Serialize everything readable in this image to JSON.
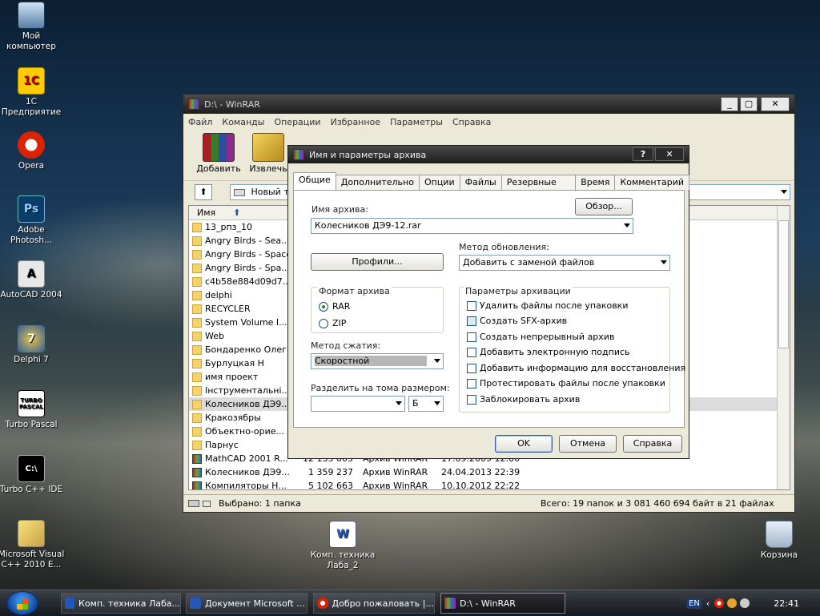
{
  "desktop": {
    "icons": [
      {
        "label": "Мой\nкомпьютер",
        "icon": "my-computer-icon"
      },
      {
        "label": "1С\nПредприятие",
        "icon": "1c-icon"
      },
      {
        "label": "Opera",
        "icon": "opera-icon"
      },
      {
        "label": "Adobe\nPhotosh...",
        "icon": "photoshop-icon"
      },
      {
        "label": "AutoCAD 2004",
        "icon": "autocad-icon"
      },
      {
        "label": "Delphi 7",
        "icon": "delphi-icon"
      },
      {
        "label": "Turbo Pascal",
        "icon": "turbo-pascal-icon"
      },
      {
        "label": "Turbo C++ IDE",
        "icon": "turbo-cpp-icon"
      },
      {
        "label": "Microsoft Visual\nC++ 2010 E...",
        "icon": "visual-cpp-icon"
      },
      {
        "label": "Комп. техника\nЛаба_2",
        "icon": "word-doc-icon"
      },
      {
        "label": "Корзина",
        "icon": "recycle-bin-icon"
      }
    ],
    "icon_texts": {
      "ps": "Ps",
      "turbo_pascal": "TURBO PASCAL",
      "turbo_cpp": "C:\\"
    }
  },
  "winrar": {
    "title": "D:\\ - WinRAR",
    "menu": [
      "Файл",
      "Команды",
      "Операции",
      "Избранное",
      "Параметры",
      "Справка"
    ],
    "toolbar": {
      "add": "Добавить",
      "extract": "Извлечь"
    },
    "address": "Новый то",
    "columns": {
      "name": "Имя"
    },
    "rows": [
      {
        "name": "13_рпз_10",
        "kind": "folder"
      },
      {
        "name": "Angry Birds - Sea...",
        "kind": "folder"
      },
      {
        "name": "Angry Birds - Space",
        "kind": "folder"
      },
      {
        "name": "Angry Birds - Spa...",
        "kind": "folder"
      },
      {
        "name": "c4b58e884d09d7...",
        "kind": "folder"
      },
      {
        "name": "delphi",
        "kind": "folder"
      },
      {
        "name": "RECYCLER",
        "kind": "folder"
      },
      {
        "name": "System Volume I...",
        "kind": "folder"
      },
      {
        "name": "Web",
        "kind": "folder"
      },
      {
        "name": "Бондаренко Олег",
        "kind": "folder"
      },
      {
        "name": "Бурлуцкая Н",
        "kind": "folder"
      },
      {
        "name": "имя проект",
        "kind": "folder"
      },
      {
        "name": "Інструментальні...",
        "kind": "folder"
      },
      {
        "name": "Колесников ДЭ9...",
        "kind": "folder",
        "selected": true
      },
      {
        "name": "Кракозябры",
        "kind": "folder"
      },
      {
        "name": "Объектно-орие...",
        "kind": "folder"
      },
      {
        "name": "Парнус",
        "kind": "folder"
      },
      {
        "name": "MathCAD 2001 R...",
        "kind": "rar",
        "size": "12 135 005",
        "type": "Архив WinRAR",
        "date": "17.09.2009 12:00"
      },
      {
        "name": "Колесников ДЭ9...",
        "kind": "rar",
        "size": "1 359 237",
        "type": "Архив WinRAR",
        "date": "24.04.2013 22:39"
      },
      {
        "name": "Компиляторы Н...",
        "kind": "rar",
        "size": "5 102 663",
        "type": "Архив WinRAR",
        "date": "10.10.2012 22:22"
      }
    ],
    "status": {
      "left": "Выбрано: 1 папка",
      "right": "Всего: 19 папок и 3 081 460 694 байт в 21 файлах"
    }
  },
  "dialog": {
    "title": "Имя и параметры архива",
    "help_btn": "?",
    "close_btn": "✕",
    "tabs": [
      "Общие",
      "Дополнительно",
      "Опции",
      "Файлы",
      "Резервные копии",
      "Время",
      "Комментарий"
    ],
    "archive_name_label": "Имя архива:",
    "archive_name": "Колесников ДЭ9-12.rar",
    "browse": "Обзор...",
    "update_method_label": "Метод обновления:",
    "update_method": "Добавить с заменой файлов",
    "profiles": "Профили...",
    "format_label": "Формат архива",
    "format_rar": "RAR",
    "format_zip": "ZIP",
    "compression_label": "Метод сжатия:",
    "compression": "Скоростной",
    "split_label": "Разделить на тома размером:",
    "split_value": "",
    "split_unit": "Б",
    "params_label": "Параметры архивации",
    "options": [
      {
        "label": "Удалить файлы после упаковки",
        "checked": false
      },
      {
        "label": "Создать SFX-архив",
        "checked": false
      },
      {
        "label": "Создать непрерывный архив",
        "checked": false
      },
      {
        "label": "Добавить электронную подпись",
        "checked": false
      },
      {
        "label": "Добавить информацию для восстановления",
        "checked": false
      },
      {
        "label": "Протестировать файлы после упаковки",
        "checked": false
      },
      {
        "label": "Заблокировать архив",
        "checked": false
      }
    ],
    "ok": "OK",
    "cancel": "Отмена",
    "help": "Справка"
  },
  "taskbar": {
    "tasks": [
      "Комп. техника Лаба...",
      "Документ Microsoft ...",
      "Добро пожаловать |...",
      "D:\\ - WinRAR"
    ],
    "lang": "EN",
    "clock": "22:41"
  }
}
